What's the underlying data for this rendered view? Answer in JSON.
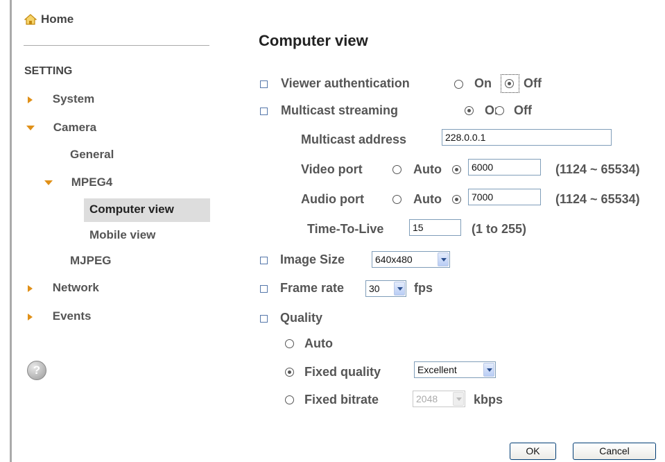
{
  "sidebar": {
    "home": "Home",
    "section": "SETTING",
    "items": {
      "system": "System",
      "camera": "Camera",
      "general": "General",
      "mpeg4": "MPEG4",
      "computer_view": "Computer view",
      "mobile_view": "Mobile view",
      "mjpeg": "MJPEG",
      "network": "Network",
      "events": "Events"
    },
    "help": "?"
  },
  "main": {
    "title": "Computer view",
    "viewer_auth": {
      "label": "Viewer authentication",
      "on": "On",
      "off": "Off",
      "selected": "Off"
    },
    "multicast": {
      "label": "Multicast streaming",
      "on": "On",
      "off": "Off",
      "selected": "On",
      "address_label": "Multicast address",
      "address_value": "228.0.0.1",
      "video_port_label": "Video port",
      "video_auto": "Auto",
      "video_port_value": "6000",
      "video_range": "(1124 ~ 65534)",
      "audio_port_label": "Audio port",
      "audio_auto": "Auto",
      "audio_port_value": "7000",
      "audio_range": "(1124 ~ 65534)",
      "ttl_label": "Time-To-Live",
      "ttl_value": "15",
      "ttl_range": "(1 to 255)"
    },
    "image_size": {
      "label": "Image Size",
      "value": "640x480"
    },
    "frame_rate": {
      "label": "Frame rate",
      "value": "30",
      "unit": "fps"
    },
    "quality": {
      "label": "Quality",
      "auto": "Auto",
      "fixed_quality": "Fixed quality",
      "fixed_quality_value": "Excellent",
      "fixed_bitrate": "Fixed bitrate",
      "fixed_bitrate_value": "2048",
      "bitrate_unit": "kbps",
      "selected": "Fixed quality"
    },
    "buttons": {
      "ok": "OK",
      "cancel": "Cancel"
    }
  },
  "colors": {
    "nav_arrow": "#e09018",
    "active_bg": "#dddddd",
    "text": "#555555"
  }
}
